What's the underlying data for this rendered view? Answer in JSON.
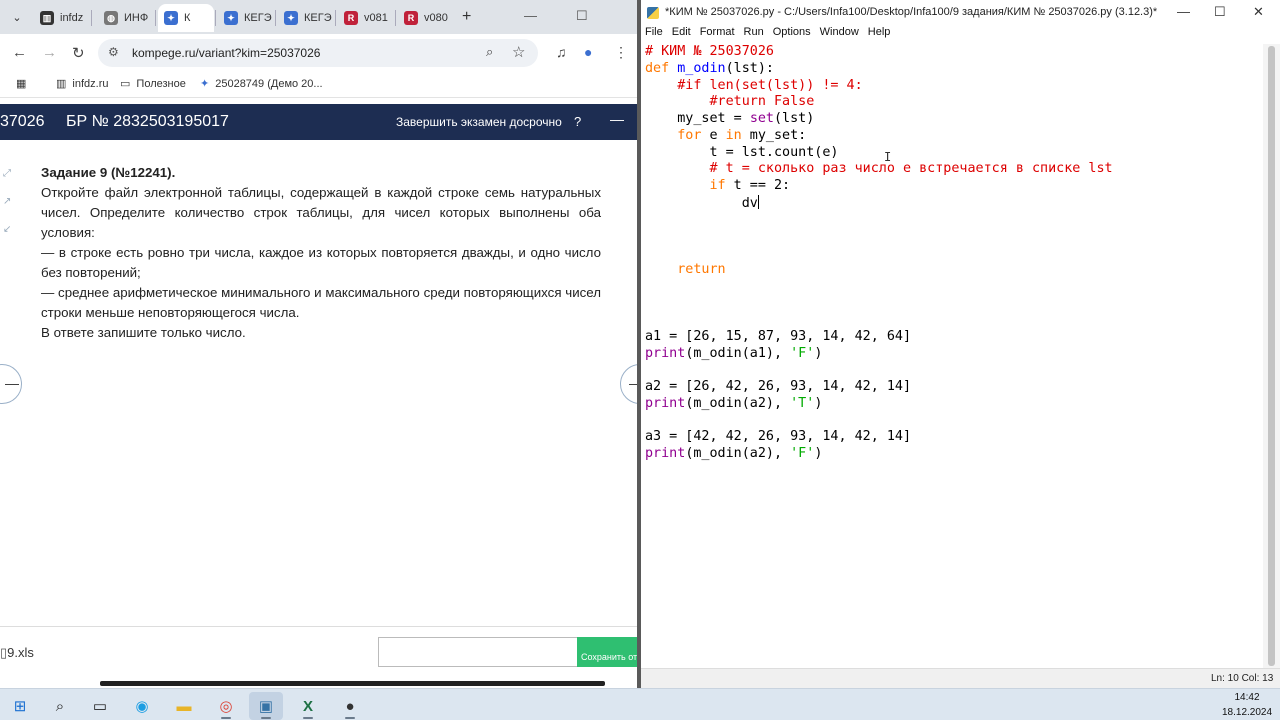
{
  "browser": {
    "tabs": [
      {
        "label": "infdz",
        "icon": "infdz-icon",
        "active": false
      },
      {
        "label": "ИНФ",
        "icon": "globe-icon",
        "active": false
      },
      {
        "label": "К",
        "icon": "kege-icon",
        "active": true
      },
      {
        "label": "КЕГЭ",
        "icon": "kege-icon",
        "active": false
      },
      {
        "label": "КЕГЭ",
        "icon": "kege-icon",
        "active": false
      },
      {
        "label": "v081",
        "icon": "r-icon",
        "active": false
      },
      {
        "label": "v080",
        "icon": "r-icon",
        "active": false
      }
    ],
    "url": "kompege.ru/variant?kim=25037026",
    "bookmarks": [
      {
        "label": "infdz.ru",
        "icon": "infdz-icon"
      },
      {
        "label": "Полезное",
        "icon": "folder-icon"
      },
      {
        "label": "25028749 (Демо 20...",
        "icon": "kege-icon"
      }
    ]
  },
  "exam_header": {
    "kim": "37026",
    "br": "БР № 2832503195017",
    "finish": "Завершить экзамен досрочно",
    "help": "?",
    "minimize": "—"
  },
  "task": {
    "title": "Задание 9 (№12241).",
    "p1": "Откройте файл электронной таблицы, содержащей в каждой строке семь натуральных чисел. Определите количество строк таблицы, для чисел которых выполнены оба условия:",
    "p2": "— в строке есть ровно три числа, каждое из которых повторяется дважды, и одно число без повторений;",
    "p3": "— среднее арифметическое минимального и максимального среди повторяющихся чисел строки меньше неповторяющегося числа.",
    "p4": "В ответе запишите только число."
  },
  "answer": {
    "file": "9.xls",
    "save_label": "Сохранить ответ",
    "value": ""
  },
  "idle": {
    "title": "*КИМ № 25037026.py - C:/Users/Infa100/Desktop/Infa100/9 задания/КИМ № 25037026.py (3.12.3)*",
    "menu": [
      "File",
      "Edit",
      "Format",
      "Run",
      "Options",
      "Window",
      "Help"
    ],
    "status": "Ln: 10   Col: 13",
    "code_lines": [
      [
        [
          "c-com",
          "# КИМ № 25037026"
        ]
      ],
      [
        [
          "c-kw",
          "def "
        ],
        [
          "c-def",
          "m_odin"
        ],
        [
          "",
          "(lst):"
        ]
      ],
      [
        [
          "",
          "    "
        ],
        [
          "c-com",
          "#if len(set(lst)) != 4:"
        ]
      ],
      [
        [
          "",
          "        "
        ],
        [
          "c-com",
          "#return False"
        ]
      ],
      [
        [
          "",
          "    my_set = "
        ],
        [
          "c-bi",
          "set"
        ],
        [
          "",
          "(lst)"
        ]
      ],
      [
        [
          "",
          "    "
        ],
        [
          "c-kw",
          "for"
        ],
        [
          "",
          " e "
        ],
        [
          "c-kw",
          "in"
        ],
        [
          "",
          " my_set:"
        ]
      ],
      [
        [
          "",
          "        t = lst.count(e)"
        ]
      ],
      [
        [
          "",
          "        "
        ],
        [
          "c-com",
          "# t = сколько раз число e встречается в списке lst"
        ]
      ],
      [
        [
          "",
          "        "
        ],
        [
          "c-kw",
          "if"
        ],
        [
          "",
          " t == 2:"
        ]
      ],
      [
        [
          "",
          "            dv"
        ]
      ],
      [
        [
          "",
          ""
        ]
      ],
      [
        [
          "",
          ""
        ]
      ],
      [
        [
          "",
          ""
        ]
      ],
      [
        [
          "",
          "    "
        ],
        [
          "c-kw",
          "return"
        ]
      ],
      [
        [
          "",
          ""
        ]
      ],
      [
        [
          "",
          ""
        ]
      ],
      [
        [
          "",
          ""
        ]
      ],
      [
        [
          "",
          "a1 = [26, 15, 87, 93, 14, 42, 64]"
        ]
      ],
      [
        [
          "c-bi",
          "print"
        ],
        [
          "",
          "(m_odin(a1), "
        ],
        [
          "c-str",
          "'F'"
        ],
        [
          "",
          ")"
        ]
      ],
      [
        [
          "",
          ""
        ]
      ],
      [
        [
          "",
          "a2 = [26, 42, 26, 93, 14, 42, 14]"
        ]
      ],
      [
        [
          "c-bi",
          "print"
        ],
        [
          "",
          "(m_odin(a2), "
        ],
        [
          "c-str",
          "'T'"
        ],
        [
          "",
          ")"
        ]
      ],
      [
        [
          "",
          ""
        ]
      ],
      [
        [
          "",
          "a3 = [42, 42, 26, 93, 14, 42, 14]"
        ]
      ],
      [
        [
          "c-bi",
          "print"
        ],
        [
          "",
          "(m_odin(a2), "
        ],
        [
          "c-str",
          "'F'"
        ],
        [
          "",
          ")"
        ]
      ]
    ]
  },
  "taskbar": {
    "items": [
      {
        "name": "start-icon",
        "glyph": "⊞"
      },
      {
        "name": "search-icon",
        "glyph": "⌕"
      },
      {
        "name": "task-view-icon",
        "glyph": "▭"
      },
      {
        "name": "edge-icon",
        "glyph": "◉"
      },
      {
        "name": "explorer-icon",
        "glyph": "▬"
      },
      {
        "name": "chrome-icon",
        "glyph": "◎"
      },
      {
        "name": "python-icon",
        "glyph": "▣"
      },
      {
        "name": "excel-icon",
        "glyph": "X"
      },
      {
        "name": "obs-icon",
        "glyph": "●"
      }
    ],
    "time": "14:42",
    "date": "18.12.2024"
  },
  "colors": {
    "exam_header": "#1d2d52",
    "save_button": "#2fbf71",
    "code_comment": "#dd0000",
    "code_keyword": "#ff7700",
    "code_def": "#0000ff",
    "code_builtin": "#900090",
    "code_string": "#00aa00"
  }
}
